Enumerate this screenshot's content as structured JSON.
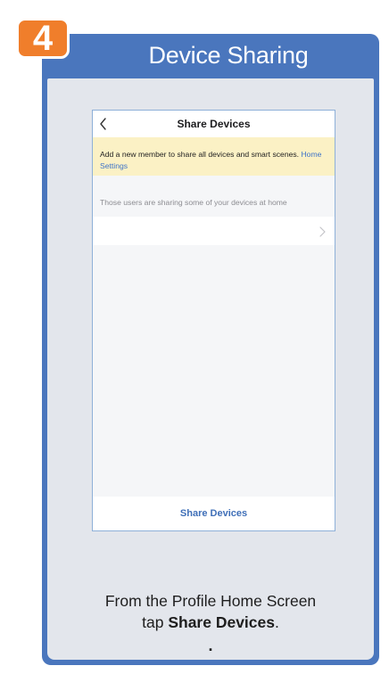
{
  "step": {
    "number": "4",
    "title": "Device Sharing"
  },
  "phone": {
    "nav_title": "Share Devices",
    "notice_text": "Add a new member to share all devices and smart scenes.",
    "notice_link": "Home Settings",
    "section_label": "Those users are sharing some of your devices at home",
    "footer_button": "Share Devices"
  },
  "caption": {
    "line1": "From the Profile Home Screen",
    "line2_prefix": "tap ",
    "line2_strong": "Share Devices",
    "line2_suffix": ".",
    "dot": "."
  },
  "colors": {
    "card_blue": "#4a76bd",
    "badge_orange": "#f07e2b",
    "notice_yellow": "#fbf1c5",
    "link_blue": "#3f74c8"
  },
  "icons": {
    "back": "chevron-left-icon",
    "row": "chevron-right-icon"
  }
}
